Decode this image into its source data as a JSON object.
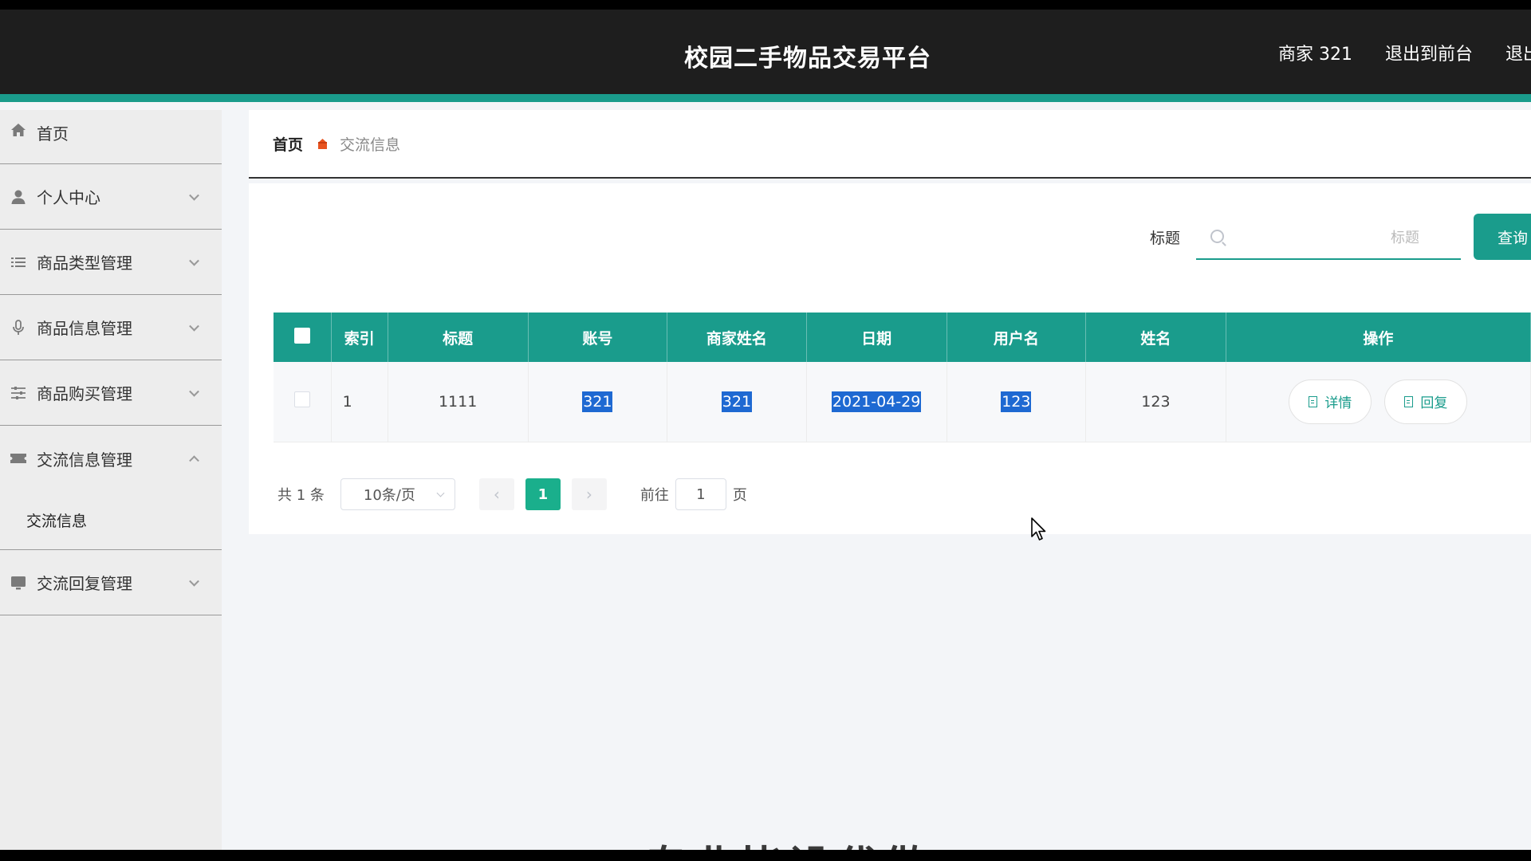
{
  "header": {
    "title": "校园二手物品交易平台",
    "user": "商家 321",
    "exit_front": "退出到前台",
    "exit_partial": "退出"
  },
  "sidebar": {
    "items": [
      {
        "label": "首页",
        "icon": "home-icon"
      },
      {
        "label": "个人中心",
        "icon": "user-icon"
      },
      {
        "label": "商品类型管理",
        "icon": "list-icon"
      },
      {
        "label": "商品信息管理",
        "icon": "mic-icon"
      },
      {
        "label": "商品购买管理",
        "icon": "sliders-icon"
      },
      {
        "label": "交流信息管理",
        "icon": "ticket-icon",
        "expanded": true
      },
      {
        "label": "交流回复管理",
        "icon": "monitor-icon"
      }
    ],
    "submenu": "交流信息"
  },
  "breadcrumb": {
    "home": "首页",
    "current": "交流信息"
  },
  "search": {
    "label": "标题",
    "placeholder": "标题",
    "button": "查询"
  },
  "table": {
    "headers": [
      "索引",
      "标题",
      "账号",
      "商家姓名",
      "日期",
      "用户名",
      "姓名",
      "操作"
    ],
    "rows": [
      {
        "index": "1",
        "title": "1111",
        "account": "321",
        "merchant_name": "321",
        "date": "2021-04-29",
        "username": "123",
        "name": "123"
      }
    ],
    "actions": {
      "detail": "详情",
      "reply": "回复"
    }
  },
  "pagination": {
    "total": "共 1 条",
    "page_size": "10条/页",
    "current_page": "1",
    "goto_label": "前往",
    "goto_value": "1",
    "goto_unit": "页"
  },
  "watermark": "专业毕设代做",
  "colors": {
    "accent": "#1a9c8c",
    "header_bg": "#1e1e1e",
    "selection": "#1e69d2"
  }
}
